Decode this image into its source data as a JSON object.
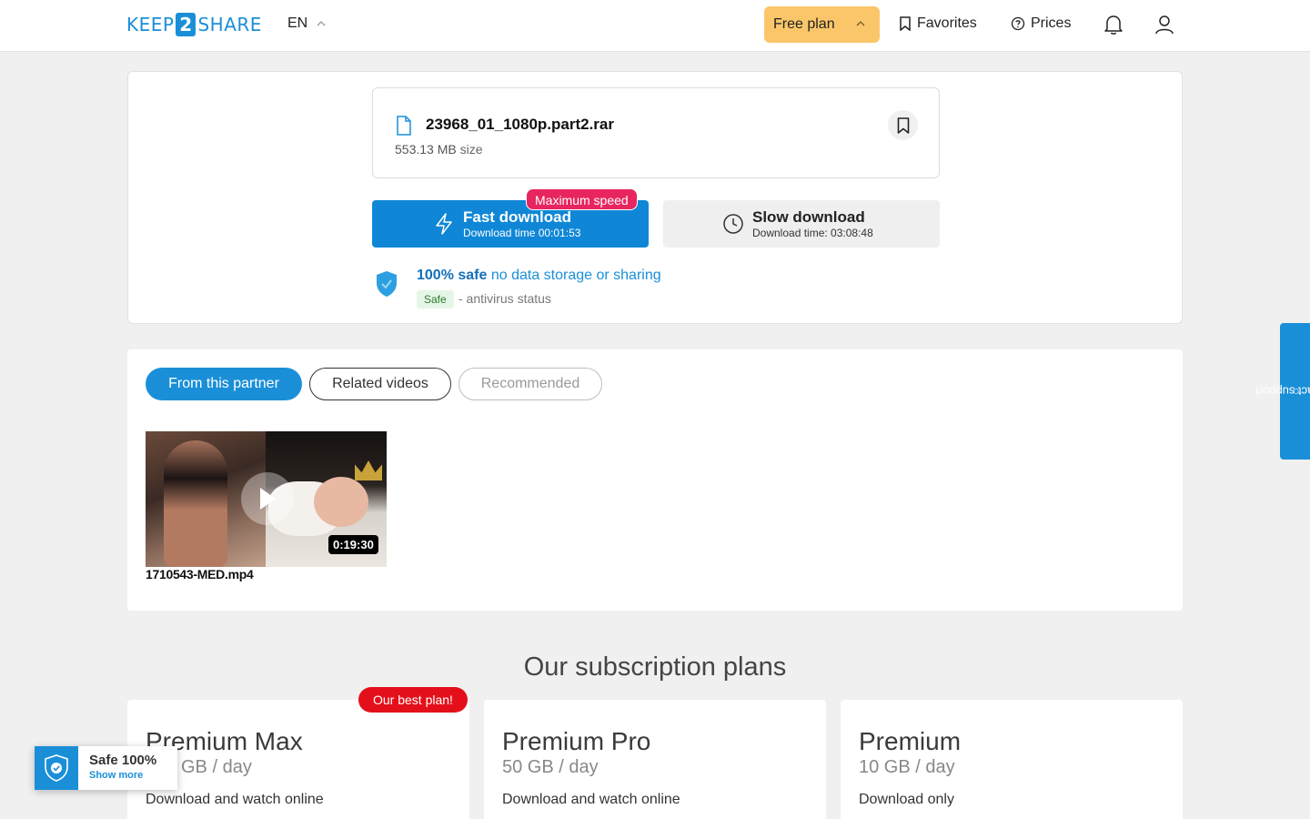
{
  "header": {
    "logo": {
      "left": "KEEP",
      "mid": "2",
      "right": "SHARE"
    },
    "lang": "EN",
    "plan_label": "Free plan",
    "favorites_label": "Favorites",
    "prices_label": "Prices"
  },
  "file": {
    "name": "23968_01_1080p.part2.rar",
    "size_value": "553.13 MB",
    "size_suffix": "size"
  },
  "download": {
    "fast_title": "Fast download",
    "fast_sub": "Download time 00:01:53",
    "max_badge": "Maximum speed",
    "slow_title": "Slow download",
    "slow_sub": "Download time: 03:08:48"
  },
  "safety": {
    "safe_strong": "100% safe",
    "safe_rest": "no data storage or sharing",
    "badge": "Safe",
    "status": "- antivirus status"
  },
  "tabs": [
    {
      "label": "From this partner"
    },
    {
      "label": "Related videos"
    },
    {
      "label": "Recommended"
    }
  ],
  "videos": [
    {
      "title": "1710543-MED.mp4",
      "duration": "0:19:30"
    }
  ],
  "plans": {
    "heading": "Our subscription plans",
    "best_badge": "Our best plan!",
    "items": [
      {
        "name": "Premium Max",
        "quota": "GB / day",
        "desc": "Download and watch online"
      },
      {
        "name": "Premium Pro",
        "quota": "50 GB / day",
        "desc": "Download and watch online"
      },
      {
        "name": "Premium",
        "quota": "10 GB / day",
        "desc": "Download only"
      }
    ]
  },
  "safe_widget": {
    "title": "Safe 100%",
    "link": "Show more"
  },
  "contact_label": "contact support",
  "colors": {
    "brand": "#1a8fd8",
    "plan_yellow": "#fbc66a",
    "badge_pink": "#e8255f",
    "badge_red": "#e3101b"
  }
}
